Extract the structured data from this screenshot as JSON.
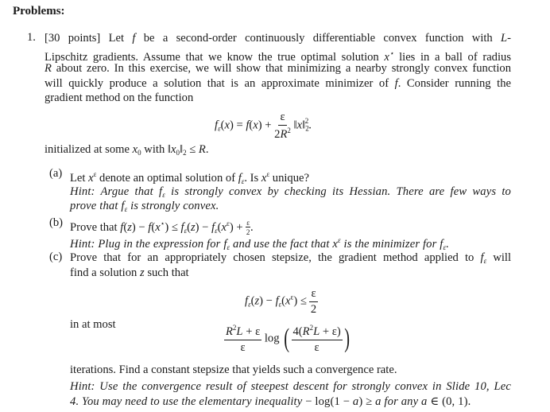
{
  "heading": "Problems:",
  "problem": {
    "number": "1.",
    "points": "[30 points]",
    "intro_lines": [
      "Let f be a second-order continuously differentiable convex function with L-",
      "Lipschitz gradients. Assume that we know the true optimal solution x* lies in a ball of radius",
      "R about zero. In this exercise, we will show that minimizing a nearby strongly convex function",
      "will quickly produce a solution that is an approximate minimizer of f. Consider running the",
      "gradient method on the function"
    ],
    "equation_main": "f_ε(x) = f(x) + ε/(2R²) ‖x‖₂².",
    "init_text": "initialized at some x₀ with ‖x₀‖₂ ≤ R.",
    "parts": [
      {
        "label": "(a)",
        "statement": "Let x^ε denote an optimal solution of f_ε. Is x^ε unique?",
        "hint_lines": [
          "Hint: Argue that f_ε is strongly convex by checking its Hessian. There are few ways to",
          "prove that f_ε is strongly convex."
        ]
      },
      {
        "label": "(b)",
        "statement": "Prove that f(z) − f(x*) ≤ f_ε(z) − f_ε(x^ε) + ε/2.",
        "hint_lines": [
          "Hint: Plug in the expression for f_ε and use the fact that x^ε is the minimizer for f_ε."
        ]
      },
      {
        "label": "(c)",
        "statement_lines": [
          "Prove that for an appropriately chosen stepsize, the gradient method applied to f_ε will",
          "find a solution z such that"
        ],
        "equation_1": "f_ε(z) − f_ε(x^ε) ≤ ε/2",
        "in_at_most": "in at most",
        "equation_2": "(R²L + ε)/ε · log(4(R²L + ε)/ε)",
        "after": "iterations. Find a constant stepsize that yields such a convergence rate.",
        "hint_lines": [
          "Hint: Use the convergence result of steepest descent for strongly convex in Slide 10, Lec",
          "4. You may need to use the elementary inequality − log(1 − a) ≥ a for any a ∈ (0, 1)."
        ]
      }
    ]
  },
  "words": {
    "let": "Let",
    "be_a": "be a second-order continuously differentiable convex function with",
    "L_dash": "L-",
    "lipschitz": "Lipschitz gradients. Assume that we know the true optimal solution",
    "lies": "lies in a ball of radius",
    "about": "about zero. In this exercise, we will show that minimizing a nearby strongly convex function",
    "quickly": "will quickly produce a solution that is an approximate minimizer of",
    "consider": ". Consider running the",
    "gradient": "gradient method on the function",
    "initialized": "initialized at some",
    "with": "with",
    "a_let": "Let",
    "a_denote": "denote an optimal solution of",
    "a_is": ". Is",
    "a_unique": "unique?",
    "a_h1a": "Hint: Argue that",
    "a_h1b": "is strongly convex by checking its Hessian. There are few ways to",
    "a_h2a": "prove that",
    "a_h2b": "is strongly convex.",
    "b_prove": "Prove that",
    "b_h1a": "Hint: Plug in the expression for",
    "b_h1b": "and use the fact that",
    "b_h1c": "is the minimizer for",
    "c_l1": "Prove that for an appropriately chosen stepsize, the gradient method applied to",
    "c_will": "will",
    "c_l2": "find a solution",
    "c_such": "such that",
    "log": "log",
    "c_hint1": "Hint: Use the convergence result of steepest descent for strongly convex in Slide 10, Lec",
    "c_hint2a": "4. You may need to use the elementary inequality",
    "c_hint2b": "for any",
    "c_hint2c": "(0, 1)."
  }
}
